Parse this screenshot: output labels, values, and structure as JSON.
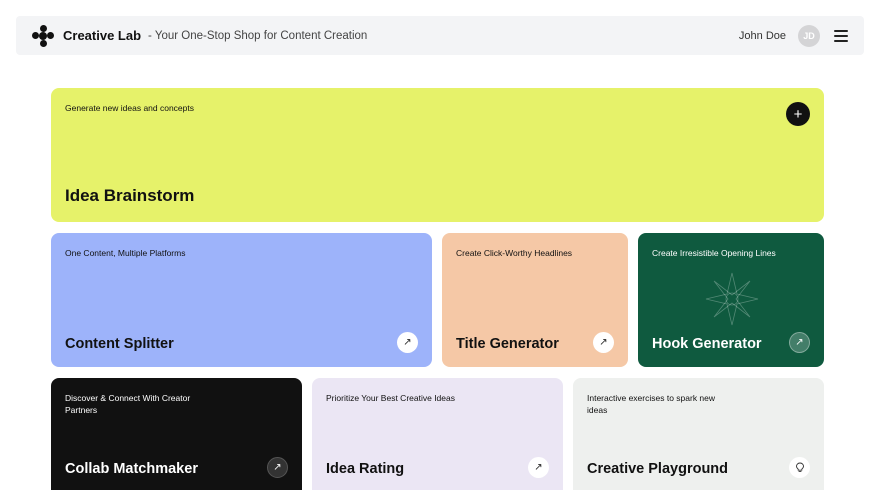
{
  "header": {
    "brand": "Creative Lab",
    "tagline": "- Your One-Stop Shop for Content Creation",
    "user_name": "John Doe",
    "avatar_initials": "JD",
    "logo_icon": "molecule-logo",
    "menu_icon": "hamburger-menu-icon"
  },
  "cards": {
    "idea_brainstorm": {
      "desc": "Generate new ideas and concepts",
      "title": "Idea Brainstorm",
      "action_icon": "plus-icon",
      "action_glyph": "+",
      "color": "#e6f26a"
    },
    "content_splitter": {
      "desc": "One Content, Multiple Platforms",
      "title": "Content Splitter",
      "action_icon": "arrow-up-right-icon",
      "action_glyph": "↗",
      "color": "#9db3fa"
    },
    "title_generator": {
      "desc": "Create Click-Worthy Headlines",
      "title": "Title Generator",
      "action_icon": "arrow-up-right-icon",
      "action_glyph": "↗",
      "color": "#f5c8a6"
    },
    "hook_generator": {
      "desc": "Create Irresistible Opening Lines",
      "title": "Hook Generator",
      "action_icon": "arrow-up-right-icon",
      "action_glyph": "↗",
      "color": "#0f5a3f"
    },
    "collab_matchmaker": {
      "desc": "Discover & Connect With Creator Partners",
      "title": "Collab Matchmaker",
      "action_icon": "arrow-up-right-icon",
      "action_glyph": "↗",
      "color": "#111111"
    },
    "idea_rating": {
      "desc": "Prioritize Your Best Creative Ideas",
      "title": "Idea Rating",
      "action_icon": "arrow-up-right-icon",
      "action_glyph": "↗",
      "color": "#ebe6f4"
    },
    "creative_playground": {
      "desc": "Interactive exercises to spark new ideas",
      "title": "Creative Playground",
      "action_icon": "lightbulb-icon",
      "action_glyph": "💡",
      "color": "#eef0ee"
    }
  }
}
